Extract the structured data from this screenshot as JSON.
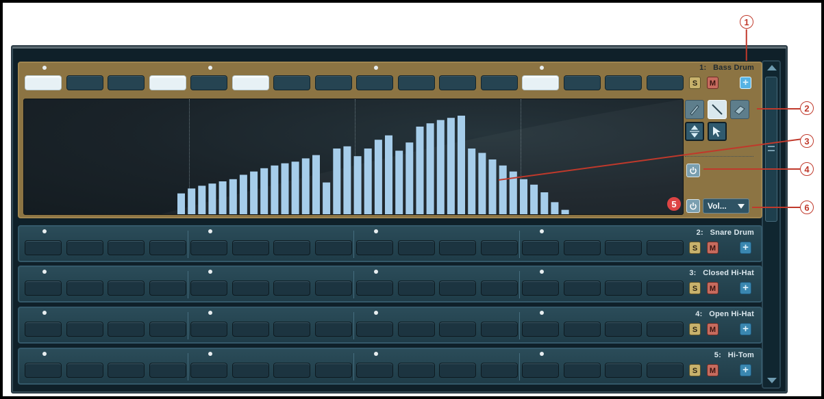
{
  "tracks": [
    {
      "index": "1:",
      "name": "Bass Drum",
      "expanded": true,
      "steps_on": [
        0,
        3,
        5,
        12
      ]
    },
    {
      "index": "2:",
      "name": "Snare Drum",
      "expanded": false,
      "steps_on": []
    },
    {
      "index": "3:",
      "name": "Closed Hi-Hat",
      "expanded": false,
      "steps_on": []
    },
    {
      "index": "4:",
      "name": "Open Hi-Hat",
      "expanded": false,
      "steps_on": []
    },
    {
      "index": "5:",
      "name": "Hi-Tom",
      "expanded": false,
      "steps_on": []
    }
  ],
  "buttons": {
    "solo": "S",
    "mute": "M",
    "add": "+"
  },
  "modulation": {
    "parameter": "Vol...",
    "values": [
      0.19,
      0.235,
      0.26,
      0.28,
      0.3,
      0.32,
      0.36,
      0.39,
      0.42,
      0.445,
      0.465,
      0.48,
      0.51,
      0.54,
      0.29,
      0.6,
      0.62,
      0.53,
      0.6,
      0.68,
      0.72,
      0.58,
      0.655,
      0.8,
      0.83,
      0.86,
      0.88,
      0.9,
      0.6,
      0.56,
      0.5,
      0.445,
      0.39,
      0.32,
      0.27,
      0.2,
      0.11,
      0.04
    ]
  },
  "callouts": [
    "1",
    "2",
    "3",
    "4",
    "5",
    "6"
  ],
  "colors": {
    "expanded_bg": "#8c7443",
    "collapsed_bg": "#1f3c48",
    "bar": "#a6cdea",
    "step_on": "#e7f1f5"
  }
}
